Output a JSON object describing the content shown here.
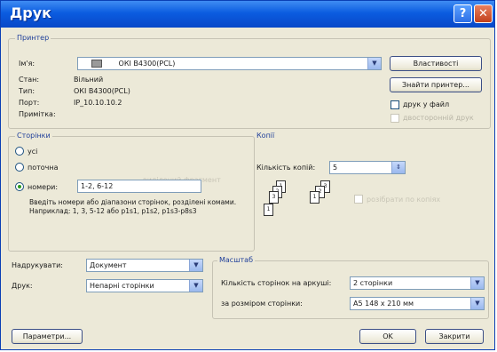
{
  "window": {
    "title": "Друк"
  },
  "printer": {
    "group_label": "Принтер",
    "name_label": "Ім'я:",
    "name_value": "ОКІ В4300(PCL)",
    "status_label": "Стан:",
    "status_value": "Вільний",
    "type_label": "Тип:",
    "type_value": "ОКІ В4300(PCL)",
    "port_label": "Порт:",
    "port_value": "IP_10.10.10.2",
    "notes_label": "Примітка:",
    "properties_button": "Властивості",
    "find_button": "Знайти принтер...",
    "print_to_file_label": "друк у файл",
    "manual_duplex_label": "двосторонній друк"
  },
  "pages": {
    "group_label": "Сторінки",
    "all_label": "усі",
    "current_label": "поточна",
    "selection_label": "виділений фрагмент",
    "range_label": "номери:",
    "range_value": "1-2, 6-12",
    "hint": "Введіть номери або діапазони сторінок, розділені комами. Наприклад: 1, 3, 5-12 або p1s1, p1s2, p1s3-p8s3"
  },
  "copies": {
    "group_label": "Копії",
    "count_label": "Кількість копій:",
    "count_value": "5",
    "collate_label": "розібрати по копіях"
  },
  "include": {
    "label": "Надрукувати:",
    "value": "Документ"
  },
  "print_what": {
    "label": "Друк:",
    "value": "Непарні сторінки"
  },
  "zoom": {
    "group_label": "Масштаб",
    "pages_per_sheet_label": "Кількість сторінок на аркуші:",
    "pages_per_sheet_value": "2 сторінки",
    "scale_label": "за розміром сторінки:",
    "scale_value": "А5 148 x 210 мм"
  },
  "footer": {
    "options_button": "Параметри...",
    "ok_button": "OK",
    "close_button": "Закрити"
  }
}
